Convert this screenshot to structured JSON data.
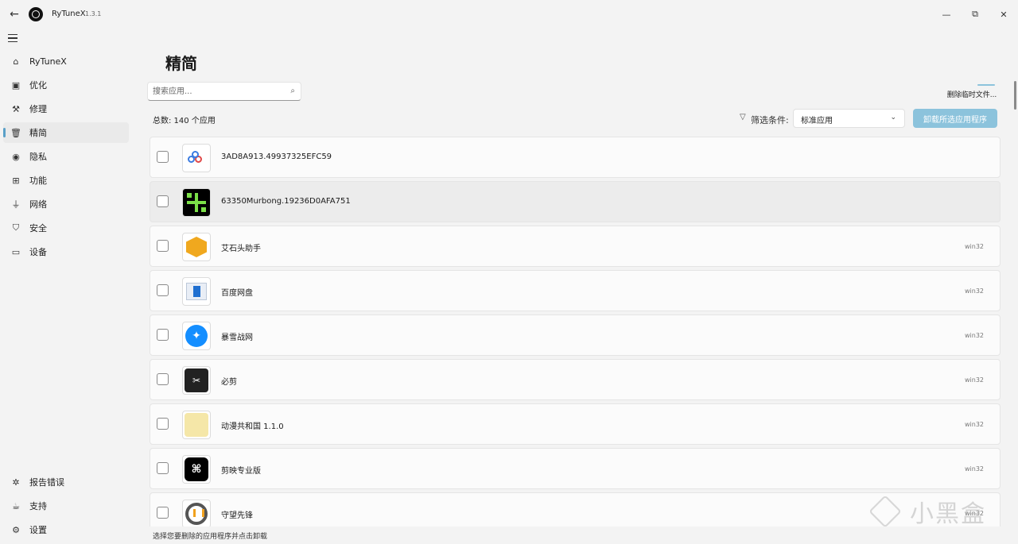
{
  "titlebar": {
    "app_name": "RyTuneX",
    "version": "1.3.1"
  },
  "sidebar": {
    "items": [
      {
        "label": "RyTuneX",
        "icon": "home-icon"
      },
      {
        "label": "优化",
        "icon": "optimize-icon"
      },
      {
        "label": "修理",
        "icon": "wrench-icon"
      },
      {
        "label": "精简",
        "icon": "trash-icon"
      },
      {
        "label": "隐私",
        "icon": "eye-icon"
      },
      {
        "label": "功能",
        "icon": "features-icon"
      },
      {
        "label": "网络",
        "icon": "network-icon"
      },
      {
        "label": "安全",
        "icon": "shield-icon"
      },
      {
        "label": "设备",
        "icon": "laptop-icon"
      }
    ],
    "bottom_items": [
      {
        "label": "报告错误",
        "icon": "bug-icon"
      },
      {
        "label": "支持",
        "icon": "support-icon"
      },
      {
        "label": "设置",
        "icon": "gear-icon"
      }
    ],
    "active": "精简"
  },
  "main": {
    "title": "精简",
    "search_placeholder": "搜索应用...",
    "delete_temp_label": "删除临时文件...",
    "total_label": "总数: 140 个应用",
    "filter_label": "筛选条件:",
    "filter_value": "标准应用",
    "uninstall_label": "卸载所选应用程序",
    "status_text": "选择您要删除的应用程序并点击卸载"
  },
  "apps": [
    {
      "name": "3AD8A913.49937325EFC59",
      "type": "",
      "icon": "blue-dots-icon"
    },
    {
      "name": "63350Murbong.19236D0AFA751",
      "type": "",
      "icon": "black-grid-icon"
    },
    {
      "name": "艾石头助手",
      "type": "win32",
      "icon": "hexagon-icon"
    },
    {
      "name": "百度网盘",
      "type": "win32",
      "icon": "baidu-disk-icon"
    },
    {
      "name": "暴雪战网",
      "type": "win32",
      "icon": "battlenet-icon"
    },
    {
      "name": "必剪",
      "type": "win32",
      "icon": "bijian-icon"
    },
    {
      "name": "动漫共和国 1.1.0",
      "type": "win32",
      "icon": "anime-icon"
    },
    {
      "name": "剪映专业版",
      "type": "win32",
      "icon": "capcut-icon"
    },
    {
      "name": "守望先锋",
      "type": "win32",
      "icon": "overwatch-icon"
    }
  ],
  "watermark": {
    "text": "小黑盒"
  }
}
